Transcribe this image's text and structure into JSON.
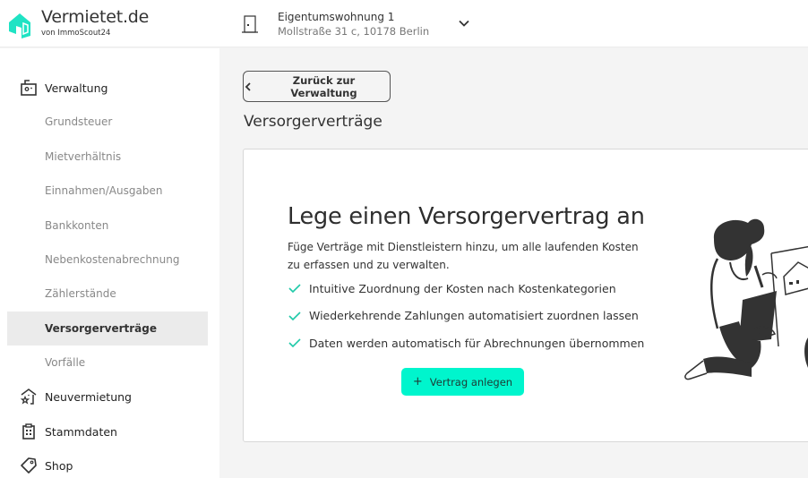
{
  "header": {
    "brand": "Vermietet.de",
    "brand_sub": "von ImmoScout24",
    "property_name": "Eigentumswohnung 1",
    "property_address": "Mollstraße 31 c, 10178 Berlin"
  },
  "sidebar": {
    "items": [
      {
        "label": "Verwaltung",
        "icon": "briefcase-icon",
        "type": "main"
      },
      {
        "label": "Grundsteuer",
        "type": "sub"
      },
      {
        "label": "Mietverhältnis",
        "type": "sub"
      },
      {
        "label": "Einnahmen/Ausgaben",
        "type": "sub"
      },
      {
        "label": "Bankkonten",
        "type": "sub"
      },
      {
        "label": "Nebenkostenabrechnung",
        "type": "sub"
      },
      {
        "label": "Zählerstände",
        "type": "sub"
      },
      {
        "label": "Versorgerverträge",
        "type": "sub",
        "active": true
      },
      {
        "label": "Vorfälle",
        "type": "sub"
      },
      {
        "label": "Neuvermietung",
        "icon": "house-star-icon",
        "type": "main"
      },
      {
        "label": "Stammdaten",
        "icon": "clipboard-icon",
        "type": "main"
      },
      {
        "label": "Shop",
        "icon": "tag-icon",
        "type": "main"
      }
    ]
  },
  "main": {
    "back_label": "Zurück zur Verwaltung",
    "page_title": "Versorgerverträge",
    "card": {
      "title": "Lege einen Versorgervertrag an",
      "description": "Füge Verträge mit Dienstleistern hinzu, um alle laufenden Kosten zu erfassen und zu verwalten.",
      "features": [
        "Intuitive Zuordnung der Kosten nach Kostenkategorien",
        "Wiederkehrende Zahlungen automatisiert zuordnen lassen",
        "Daten werden automatisch für Abrechnungen übernommen"
      ],
      "cta_label": "Vertrag anlegen",
      "cta_icon": "+"
    }
  },
  "colors": {
    "accent": "#00f5cd",
    "check": "#1ec9a8",
    "brand": "#1fe3c4"
  }
}
